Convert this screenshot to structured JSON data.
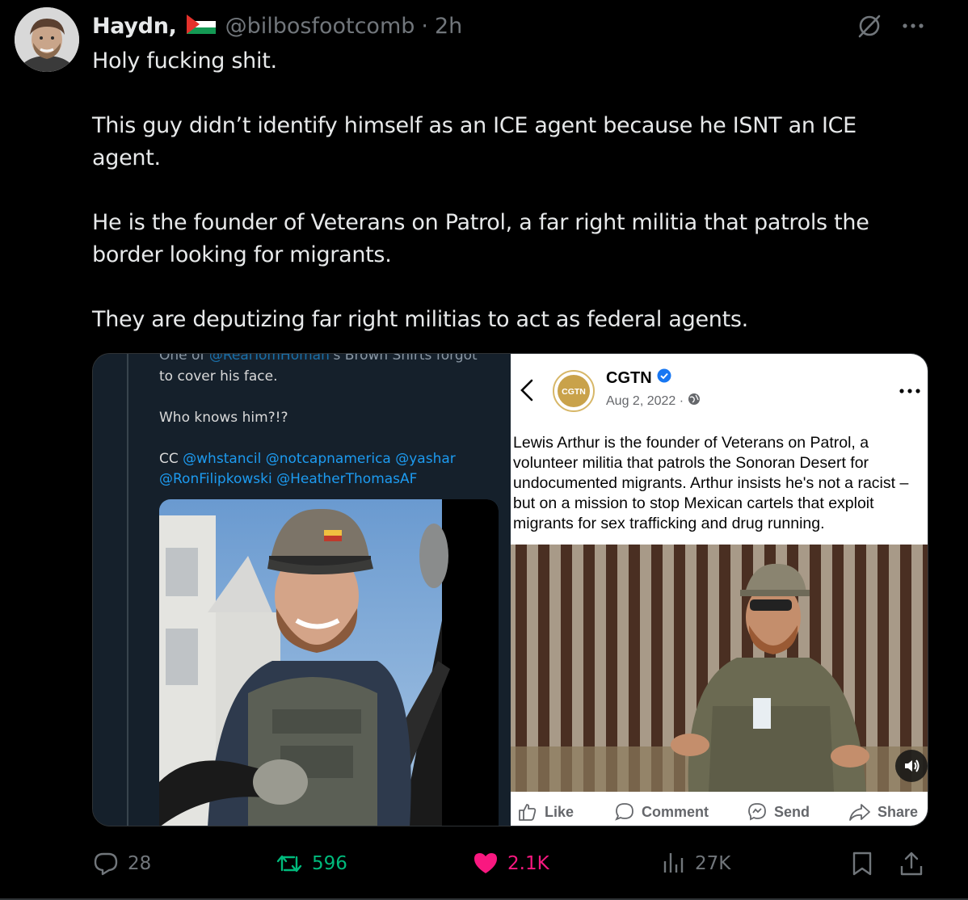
{
  "author": {
    "display_name": "Haydn,",
    "handle": "@bilbosfootcomb",
    "time": "2h",
    "separator": "·"
  },
  "tweet": {
    "paragraphs": [
      "Holy fucking shit.",
      "This guy didn’t identify himself as an ICE agent because he ISNT an ICE agent.",
      "He is the founder of Veterans on Patrol, a far right militia that patrols the border looking for migrants.",
      "They are deputizing far right militias to act as federal agents."
    ]
  },
  "quoted_screenshot": {
    "cut_line_start": "One of ",
    "cut_line_link": "@RealTomHoman",
    "cut_line_end": "'s Brown Shirts forgot",
    "line2": "to cover his face.",
    "line3": "Who knows him?!?",
    "cc_label": "CC ",
    "cc_links_line1": "@whstancil @notcapnamerica @yashar",
    "cc_links_line2": "@RonFilipkowski @HeatherThomasAF"
  },
  "facebook_post": {
    "page_name": "CGTN",
    "logo_text": "CGTN",
    "date": "Aug 2, 2022 ·",
    "text": "Lewis Arthur is the founder of Veterans on Patrol, a volunteer militia that patrols the Sonoran Desert for undocumented migrants. Arthur insists he's not a racist – but on a mission to stop Mexican cartels that exploit migrants for sex trafficking and drug running.",
    "actions": {
      "like": "Like",
      "comment": "Comment",
      "send": "Send",
      "share": "Share"
    }
  },
  "engagement": {
    "replies": "28",
    "reposts": "596",
    "likes": "2.1K",
    "views": "27K"
  },
  "colors": {
    "background": "#000000",
    "text": "#e7e9ea",
    "muted": "#71767b",
    "repost_green": "#00ba7c",
    "like_pink": "#f91880",
    "link_blue": "#1d9bf0"
  },
  "icons": [
    "avatar",
    "palestine-flag-icon",
    "grok-icon",
    "more-icon",
    "reply-icon",
    "repost-icon",
    "like-icon",
    "views-icon",
    "bookmark-icon",
    "share-icon"
  ]
}
